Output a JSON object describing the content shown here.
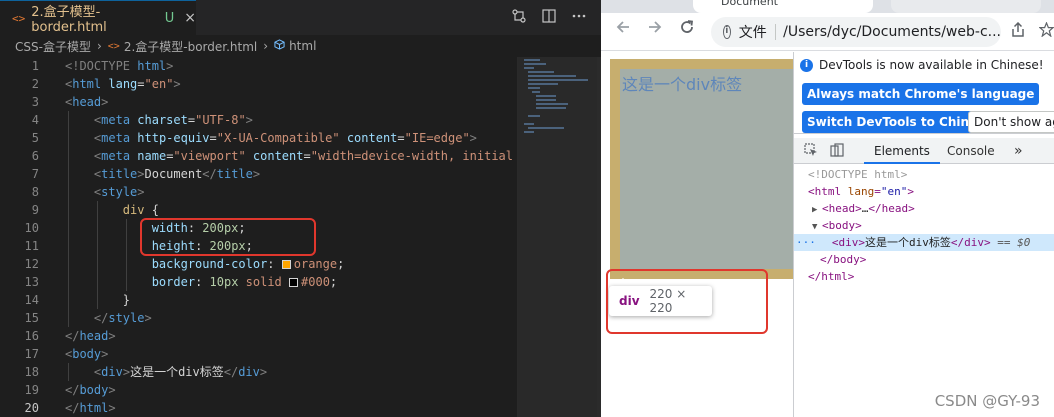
{
  "vscode": {
    "tab": {
      "icon_text": "<>",
      "title": "2.盒子模型-border.html",
      "badge": "U",
      "close": "×"
    },
    "breadcrumb": {
      "folder": "CSS-盒子模型",
      "file_icon_text": "<>",
      "file": "2.盒子模型-border.html",
      "element": "html"
    },
    "line_numbers": [
      "1",
      "2",
      "3",
      "4",
      "5",
      "6",
      "7",
      "8",
      "9",
      "10",
      "11",
      "12",
      "13",
      "14",
      "15",
      "16",
      "17",
      "18",
      "19",
      "20"
    ],
    "active_line": "20",
    "code": {
      "l1_a": "<!DOCTYPE ",
      "l1_b": "html",
      "l1_c": ">",
      "l2_tag": "html",
      "l2_attr": "lang",
      "l2_val": "\"en\"",
      "l3_tag": "head",
      "l4_tag": "meta",
      "l4_attr": "charset",
      "l4_val": "\"UTF-8\"",
      "l5_tag": "meta",
      "l5_attr1": "http-equiv",
      "l5_val1": "\"X-UA-Compatible\"",
      "l5_attr2": "content",
      "l5_val2": "\"IE=edge\"",
      "l6_tag": "meta",
      "l6_attr1": "name",
      "l6_val1": "\"viewport\"",
      "l6_attr2": "content",
      "l6_val2": "\"width=device-width, initial-",
      "l7_tag": "title",
      "l7_text": "Document",
      "l8_tag": "style",
      "l9_sel": "div",
      "l9_brace": " {",
      "l10_prop": "width",
      "l10_val": "200px",
      "l11_prop": "height",
      "l11_val": "200px",
      "l12_prop": "background-color",
      "l12_val": "orange",
      "l13_prop": "border",
      "l13_val1": "10px",
      "l13_val2": "solid",
      "l13_val3": "#000",
      "l14_brace": "}",
      "l15_tag": "style",
      "l16_tag": "head",
      "l17_tag": "body",
      "l18_tag": "div",
      "l18_text": "这是一个div标签",
      "l19_tag": "body",
      "l20_tag": "html"
    },
    "swatch_colors": {
      "orange": "#ffa500",
      "black": "#000000"
    }
  },
  "chrome": {
    "tab_partial": "Document",
    "address_label": "文件",
    "address_url": "/Users/dyc/Documents/web-c...",
    "page": {
      "div_text": "这是一个div标签",
      "div_border_color": "#c7ae6e",
      "tooltip_tag": "div",
      "tooltip_size": "220 × 220"
    },
    "devtools": {
      "banner_text": "DevTools is now available in Chinese!",
      "btn_match": "Always match Chrome's language",
      "btn_switch": "Switch DevTools to Chinese",
      "btn_dont": "Don't show ag",
      "tab_elements": "Elements",
      "tab_console": "Console",
      "tab_more": "»",
      "dom": {
        "doctype": "<!DOCTYPE html>",
        "html_tag": "html",
        "html_attr": "lang",
        "html_val": "\"en\"",
        "head_tag": "head",
        "head_ellipsis": "…",
        "head_close": "head",
        "body_tag": "body",
        "div_tag": "div",
        "div_text": "这是一个div标签",
        "div_close": "div",
        "dollar": "== $0",
        "dots": "···",
        "body_close": "body",
        "html_close": "html"
      }
    }
  },
  "watermark": "CSDN @GY-93"
}
